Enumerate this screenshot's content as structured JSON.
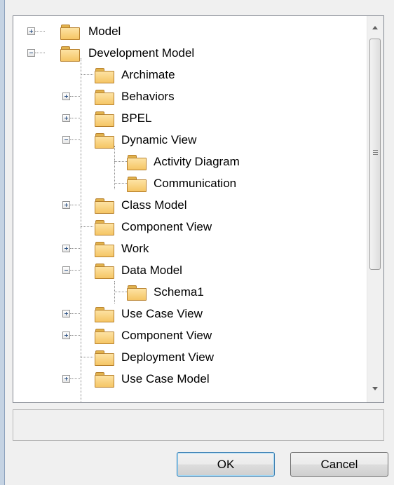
{
  "tree": {
    "items": [
      {
        "label": "Model",
        "expander": "plus"
      },
      {
        "label": "Development Model",
        "expander": "minus"
      },
      {
        "label": "Archimate",
        "expander": "none"
      },
      {
        "label": "Behaviors",
        "expander": "plus"
      },
      {
        "label": "BPEL",
        "expander": "plus"
      },
      {
        "label": "Dynamic View",
        "expander": "minus"
      },
      {
        "label": "Activity Diagram",
        "expander": "none"
      },
      {
        "label": "Communication",
        "expander": "none"
      },
      {
        "label": "Class Model",
        "expander": "plus"
      },
      {
        "label": "Component View",
        "expander": "none"
      },
      {
        "label": "Work",
        "expander": "plus"
      },
      {
        "label": "Data Model",
        "expander": "minus"
      },
      {
        "label": "Schema1",
        "expander": "none"
      },
      {
        "label": "Use Case View",
        "expander": "plus"
      },
      {
        "label": "Component View",
        "expander": "plus"
      },
      {
        "label": "Deployment View",
        "expander": "none"
      },
      {
        "label": "Use Case Model",
        "expander": "plus"
      }
    ]
  },
  "buttons": {
    "ok_label": "OK",
    "cancel_label": "Cancel"
  },
  "colors": {
    "folder": "#f5c565",
    "default_button_border": "#3c7fb1"
  }
}
